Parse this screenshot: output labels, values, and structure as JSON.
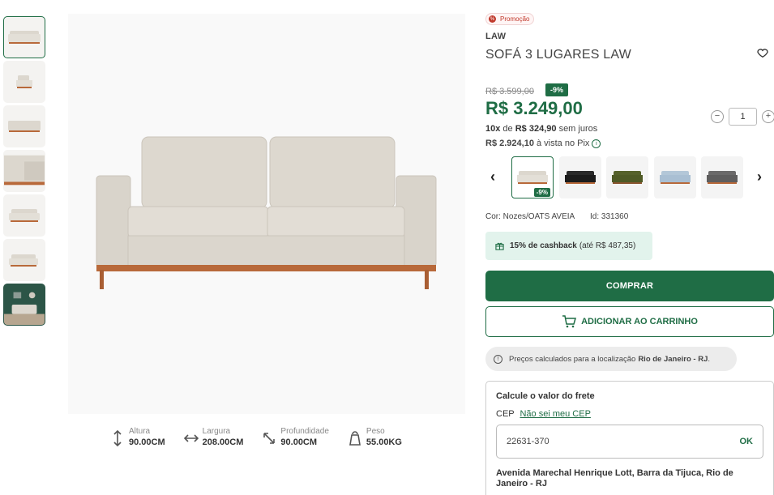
{
  "product": {
    "promo_label": "Promoção",
    "promo_icon": "percent-icon",
    "brand": "LAW",
    "title": "SOFÁ 3 LUGARES LAW",
    "old_price": "R$ 3.599,00",
    "discount": "-9%",
    "price": "R$ 3.249,00",
    "installments_count": "10x",
    "installments_of": "de",
    "installments_value": "R$ 324,90",
    "installments_suffix": "sem juros",
    "pix_price": "R$ 2.924,10",
    "pix_suffix": "à vista no Pix",
    "quantity": "1",
    "color_label": "Cor: Nozes/OATS AVEIA",
    "id_label": "Id: 331360",
    "cashback_strong": "15% de cashback",
    "cashback_rest": "(até R$ 487,35)",
    "buy_label": "COMPRAR",
    "cart_label": "ADICIONAR AO CARRINHO",
    "location_text": "Preços calculados para a localização",
    "location_city": "Rio de Janeiro - RJ",
    "location_end": "."
  },
  "variants": [
    {
      "color": "#dcd7ce",
      "badge": "-9%",
      "active": true
    },
    {
      "color": "#222222",
      "badge": "",
      "active": false
    },
    {
      "color": "#4f5a26",
      "badge": "",
      "active": false
    },
    {
      "color": "#a9bfd3",
      "badge": "",
      "active": false
    },
    {
      "color": "#5f5e5e",
      "badge": "",
      "active": false
    }
  ],
  "specs": [
    {
      "label": "Altura",
      "value": "90.00CM",
      "icon": "vertical-arrows-icon"
    },
    {
      "label": "Largura",
      "value": "208.00CM",
      "icon": "horizontal-arrows-icon"
    },
    {
      "label": "Profundidade",
      "value": "90.00CM",
      "icon": "diagonal-arrows-icon"
    },
    {
      "label": "Peso",
      "value": "55.00KG",
      "icon": "weight-icon"
    }
  ],
  "freight": {
    "title": "Calcule o valor do frete",
    "cep_label": "CEP",
    "cep_link": "Não sei meu CEP",
    "cep_value": "22631-370",
    "ok_label": "OK",
    "address": "Avenida Marechal Henrique Lott, Barra da Tijuca, Rio de Janeiro - RJ"
  },
  "colors": {
    "accent": "#1f6d45",
    "promo": "#c0392b",
    "sofa_fabric": "#dcd7ce",
    "sofa_wood": "#b8693a"
  }
}
